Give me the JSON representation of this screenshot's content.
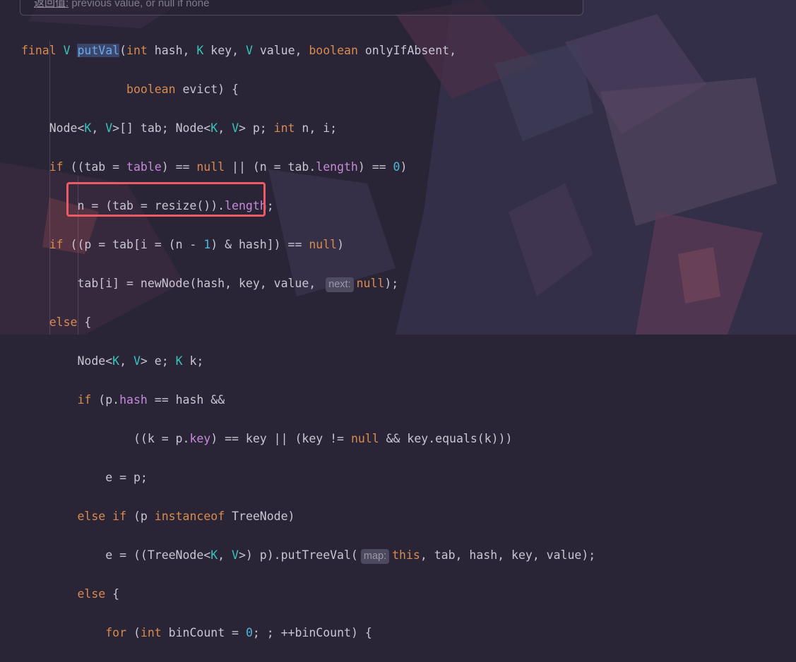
{
  "doc_comment": {
    "label": "返回值:",
    "text": " previous value, or null if none"
  },
  "code": {
    "line1": {
      "kw_final": "final",
      "type_V": "V",
      "method": "putVal",
      "p1_type": "int",
      "p1": "hash,",
      "p2_type": "K",
      "p2": "key,",
      "p3_type": "V",
      "p3": "value,",
      "p4_type": "boolean",
      "p4": "onlyIfAbsent,"
    },
    "line2": {
      "kw_boolean": "boolean",
      "rest": "evict) {"
    },
    "line3": {
      "a": "Node<",
      "K": "K",
      "b": ", ",
      "V": "V",
      "c": ">[] tab; Node<",
      "K2": "K",
      "d": ", ",
      "V2": "V",
      "e": "> p; ",
      "kw_int": "int",
      "f": " n, i;"
    },
    "line4": {
      "kw_if": "if",
      "a": " ((tab = ",
      "field": "table",
      "b": ") == ",
      "kw_null": "null",
      "c": " || (n = tab.",
      "field2": "length",
      "d": ") == ",
      "num": "0",
      "e": ")"
    },
    "line5": {
      "a": "n = (tab = resize()).",
      "field": "length",
      "b": ";"
    },
    "line6": {
      "kw_if": "if",
      "a": " ((p = tab[i = (n - ",
      "num": "1",
      "b": ") & hash]) == ",
      "kw_null": "null",
      "c": ")"
    },
    "line7": {
      "a": "tab[i] = newNode(hash, key, value, ",
      "hint": "next:",
      "kw_null": "null",
      "b": ");"
    },
    "line8": {
      "kw_else": "else",
      "a": " {"
    },
    "line9": {
      "a": "Node<",
      "K": "K",
      "b": ", ",
      "V": "V",
      "c": "> e; ",
      "K2": "K",
      "d": " k;"
    },
    "line10": {
      "kw_if": "if",
      "a": " (p.",
      "field": "hash",
      "b": " == hash &&"
    },
    "line11": {
      "a": "((k = p.",
      "field": "key",
      "b": ") == key || (key != ",
      "kw_null": "null",
      "c": " && key.equals(k)))"
    },
    "line12": {
      "a": "e = p;"
    },
    "line13": {
      "kw_else": "else",
      "kw_if": "if",
      "a": " (p ",
      "kw_instanceof": "instanceof",
      "b": " TreeNode)"
    },
    "line14": {
      "a": "e = ((TreeNode<",
      "K": "K",
      "b": ", ",
      "V": "V",
      "c": ">) p).putTreeVal(",
      "hint": "map:",
      "kw_this": "this",
      "d": ", tab, hash, key, value);"
    },
    "line15": {
      "kw_else": "else",
      "a": " {"
    },
    "line16": {
      "kw_for": "for",
      "a": " (",
      "kw_int": "int",
      "b": " binCount = ",
      "num": "0",
      "c": "; ; ++binCount) {"
    }
  },
  "colors": {
    "background": "#2a2536",
    "keyword": "#d98b4f",
    "type_param": "#38c5b8",
    "method": "#68a8f0",
    "field": "#c48bd8",
    "number": "#4fb6d8",
    "plain": "#c9c5d2",
    "highlight_box": "#ec5a66"
  }
}
